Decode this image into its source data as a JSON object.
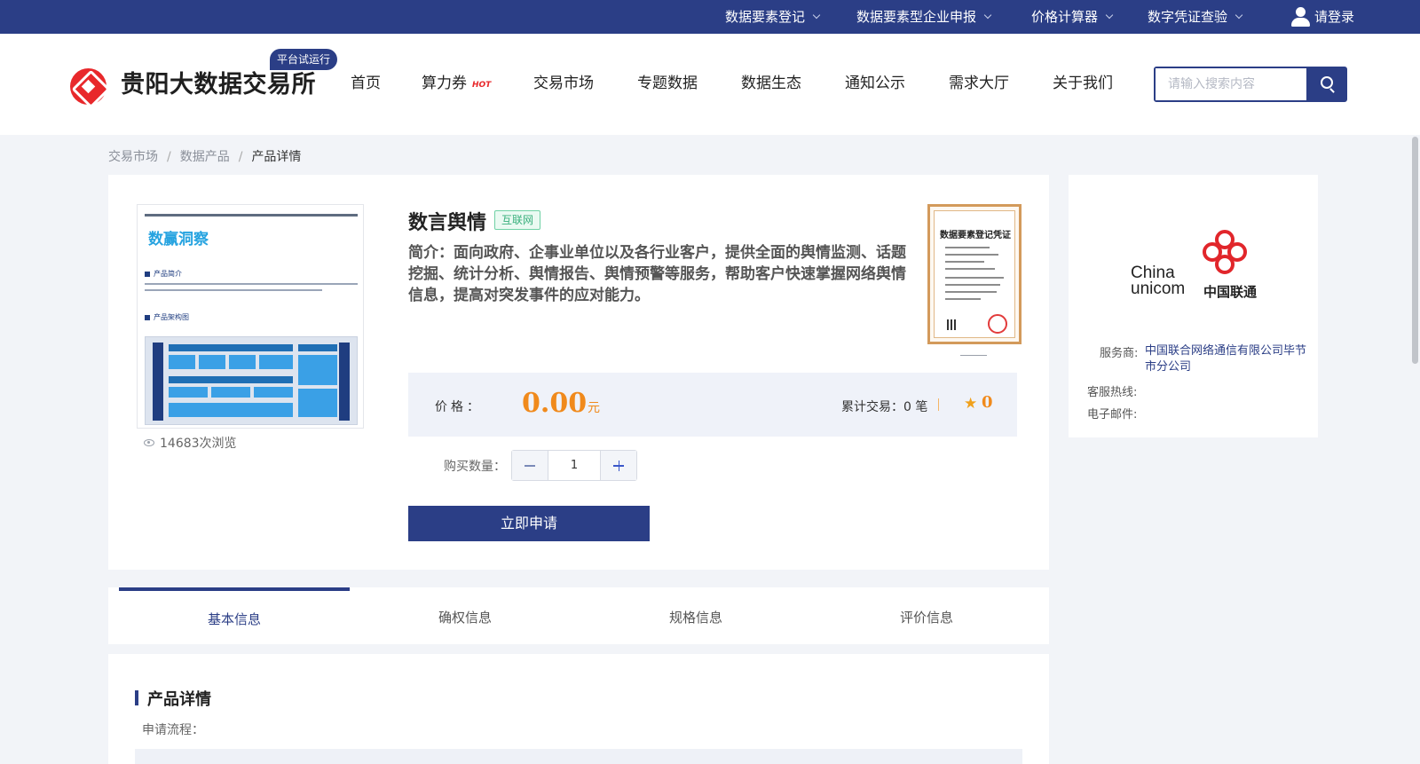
{
  "topbar": {
    "items": [
      {
        "label": "数据要素登记"
      },
      {
        "label": "数据要素型企业申报"
      },
      {
        "label": "价格计算器"
      },
      {
        "label": "数字凭证查验"
      }
    ],
    "login": "请登录"
  },
  "header": {
    "site_name": "贵阳大数据交易所",
    "trial_badge": "平台试运行",
    "nav": [
      {
        "label": "首页"
      },
      {
        "label": "算力券"
      },
      {
        "label": "交易市场"
      },
      {
        "label": "专题数据"
      },
      {
        "label": "数据生态"
      },
      {
        "label": "通知公示"
      },
      {
        "label": "需求大厅"
      },
      {
        "label": "关于我们"
      }
    ],
    "hot_badge": "HOT",
    "search_placeholder": "请输入搜索内容"
  },
  "breadcrumb": {
    "items": [
      "交易市场",
      "数据产品",
      "产品详情"
    ]
  },
  "product": {
    "name": "数言舆情",
    "tag": "互联网",
    "description": "简介：面向政府、企事业单位以及各行业客户，提供全面的舆情监测、话题挖掘、统计分析、舆情报告、舆情预警等服务，帮助客户快速掌握网络舆情信息，提高对突发事件的应对能力。",
    "thumbnail_title": "数赢洞察",
    "thumbnail_sections": [
      "产品简介",
      "产品架构图"
    ],
    "certificate_title": "数据要素登记凭证",
    "views": "14683次浏览",
    "price_label": "价格：",
    "price": "0.00",
    "price_unit": "元",
    "trade_count_label": "累计交易：0 笔",
    "rating": "0",
    "quantity_label": "购买数量：",
    "quantity": "1",
    "apply_label": "立即申请"
  },
  "provider": {
    "logo_en_1": "China",
    "logo_en_2": "unicom",
    "logo_cn": "中国联通",
    "service_label": "服务商:",
    "service_value": "中国联合网络通信有限公司毕节市分公司",
    "hotline_label": "客服热线:",
    "email_label": "电子邮件:"
  },
  "tabs": [
    {
      "label": "基本信息",
      "active": true
    },
    {
      "label": "确权信息",
      "active": false
    },
    {
      "label": "规格信息",
      "active": false
    },
    {
      "label": "评价信息",
      "active": false
    }
  ],
  "detail": {
    "title": "产品详情",
    "flow_label": "申请流程："
  },
  "colors": {
    "brand": "#2b3e86",
    "accent_price": "#f08a1c",
    "logo_red": "#e8282b",
    "tag_green": "#39b07d"
  }
}
